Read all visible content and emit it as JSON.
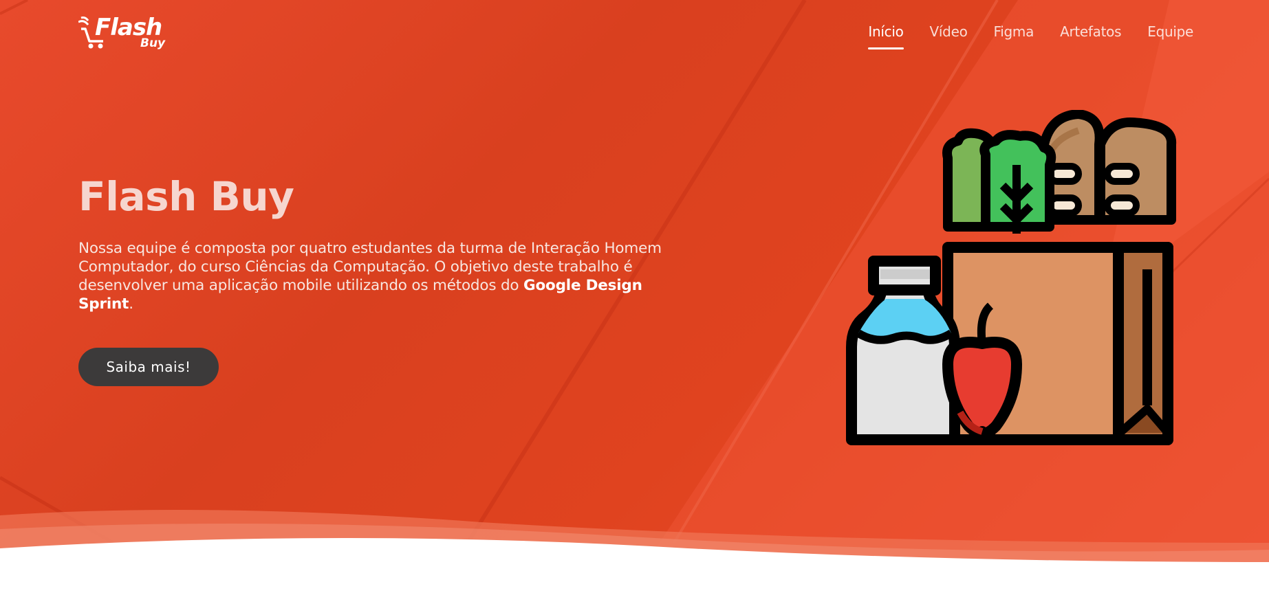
{
  "brand": {
    "logo_word_1": "Flash",
    "logo_word_2": "Buy"
  },
  "nav": {
    "items": [
      {
        "label": "Início",
        "active": true
      },
      {
        "label": "Vídeo"
      },
      {
        "label": "Figma"
      },
      {
        "label": "Artefatos"
      },
      {
        "label": "Equipe"
      }
    ]
  },
  "hero": {
    "title": "Flash Buy",
    "description": "Nossa equipe é composta por quatro estudantes da turma de Interação Homem Computador, do curso Ciências da Computação. O objetivo deste trabalho é desenvolver uma aplicação mobile utilizando os métodos do ",
    "description_bold": "Google Design Sprint",
    "description_end": ".",
    "cta_label": "Saiba mais!"
  },
  "icons": {
    "logo": "cart-lightning-icon",
    "illustration": "grocery-bag-icon"
  },
  "colors": {
    "hero_background": "#e0431f",
    "cta_background": "#3c3a3a",
    "title": "#f6d6cf"
  }
}
